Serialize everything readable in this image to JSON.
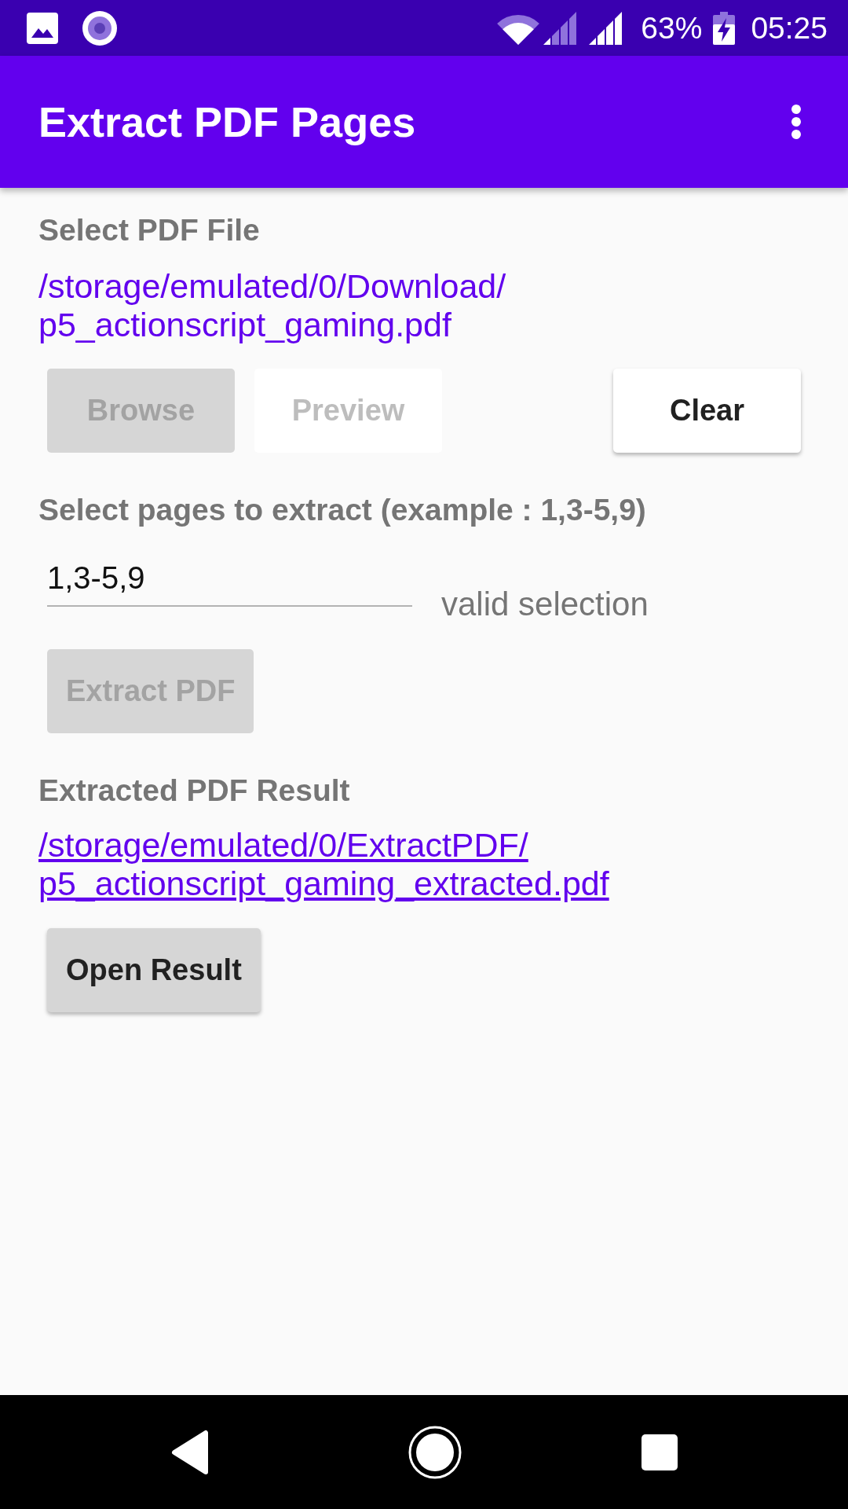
{
  "status_bar": {
    "battery": "63%",
    "time": "05:25"
  },
  "app_bar": {
    "title": "Extract PDF Pages"
  },
  "file_section": {
    "label": "Select PDF File",
    "path": "/storage/emulated/0/Download/\np5_actionscript_gaming.pdf",
    "buttons": [
      {
        "label": "Browse",
        "kind": "filled",
        "disabled": true
      },
      {
        "label": "Preview",
        "kind": "plain",
        "disabled": true
      },
      {
        "label": "Clear",
        "kind": "plain",
        "disabled": false
      }
    ]
  },
  "pages_section": {
    "label": "Select pages to extract (example : 1,3-5,9)",
    "input": {
      "value": "1,3-5,9"
    },
    "validation": "valid selection",
    "button": {
      "label": "Extract PDF",
      "kind": "filled",
      "disabled": true
    }
  },
  "result_section": {
    "label": "Extracted PDF Result",
    "link": "/storage/emulated/0/ExtractPDF/\np5_actionscript_gaming_extracted.pdf",
    "button": {
      "label": "Open Result",
      "kind": "filled",
      "disabled": false
    }
  }
}
